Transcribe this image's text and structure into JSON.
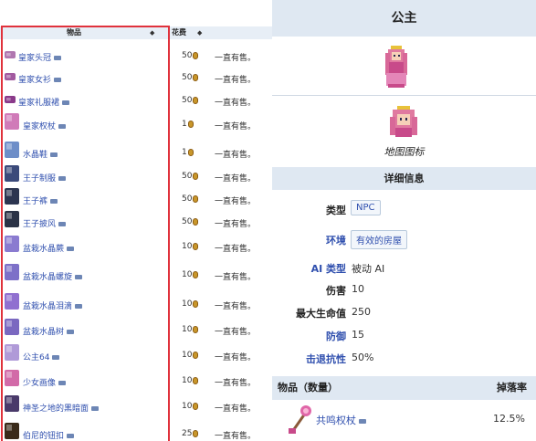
{
  "table": {
    "headers": {
      "item": "物品",
      "cost": "花费",
      "availability": ""
    },
    "rows": [
      {
        "name": "皇家头冠",
        "price": "50",
        "availability": "一直有售。",
        "icon": "crown-icon",
        "color": "#b077b0"
      },
      {
        "name": "皇家女衫",
        "price": "50",
        "availability": "一直有售。",
        "icon": "blouse-icon",
        "color": "#a25aa0"
      },
      {
        "name": "皇家礼服裙",
        "price": "50",
        "availability": "一直有售。",
        "icon": "gown-icon",
        "color": "#8a3a8a"
      },
      {
        "name": "皇家权杖",
        "price": "1",
        "availability": "一直有售。",
        "icon": "scepter-icon",
        "color": "#d07ab8"
      },
      {
        "name": "水晶鞋",
        "price": "1",
        "availability": "一直有售。",
        "icon": "glass-slipper-icon",
        "color": "#6e8ec8"
      },
      {
        "name": "王子制服",
        "price": "50",
        "availability": "一直有售。",
        "icon": "prince-uniform-icon",
        "color": "#3b4a7a"
      },
      {
        "name": "王子裤",
        "price": "50",
        "availability": "一直有售。",
        "icon": "prince-pants-icon",
        "color": "#2c3550"
      },
      {
        "name": "王子披风",
        "price": "50",
        "availability": "一直有售。",
        "icon": "prince-cape-icon",
        "color": "#2a3246"
      },
      {
        "name": "盆栽水晶蕨",
        "price": "10",
        "availability": "一直有售。",
        "icon": "crystal-fern-icon",
        "color": "#8a7bd0"
      },
      {
        "name": "盆栽水晶螺旋",
        "price": "10",
        "availability": "一直有售。",
        "icon": "crystal-spiral-icon",
        "color": "#7d70c8"
      },
      {
        "name": "盆栽水晶泪滴",
        "price": "10",
        "availability": "一直有售。",
        "icon": "crystal-teardrop-icon",
        "color": "#9070d0"
      },
      {
        "name": "盆栽水晶树",
        "price": "10",
        "availability": "一直有售。",
        "icon": "crystal-tree-icon",
        "color": "#7a68c0"
      },
      {
        "name": "公主64",
        "price": "10",
        "availability": "一直有售。",
        "icon": "princess64-icon",
        "color": "#b09ad8"
      },
      {
        "name": "少女画像",
        "price": "10",
        "availability": "一直有售。",
        "icon": "girl-portrait-icon",
        "color": "#d26aa8"
      },
      {
        "name": "神圣之地的黑暗面",
        "price": "10",
        "availability": "一直有售。",
        "icon": "dark-side-painting-icon",
        "color": "#4a3a6a"
      },
      {
        "name": "伯尼的钮扣",
        "price": "25",
        "availability": "一直有售。",
        "icon": "bernie-button-icon",
        "color": "#3a2a1a"
      }
    ]
  },
  "infobox": {
    "title": "公主",
    "map_icon_caption": "地图图标",
    "section_title": "详细信息",
    "fields": [
      {
        "label": "类型",
        "value": "NPC",
        "is_link_label": false,
        "is_pill": true
      },
      {
        "label": "环境",
        "value": "有效的房屋",
        "is_link_label": true,
        "is_pill": true
      },
      {
        "label": "AI 类型",
        "value": "被动 AI",
        "is_link_label": true,
        "is_pill": false
      },
      {
        "label": "伤害",
        "value": "10",
        "is_link_label": false,
        "is_pill": false
      },
      {
        "label": "最大生命值",
        "value": "250",
        "is_link_label": false,
        "is_pill": false
      },
      {
        "label": "防御",
        "value": "15",
        "is_link_label": true,
        "is_pill": false
      },
      {
        "label": "击退抗性",
        "value": "50%",
        "is_link_label": true,
        "is_pill": false
      }
    ],
    "drops": {
      "header_item": "物品（数量）",
      "header_rate": "掉落率",
      "items": [
        {
          "name": "共鸣权杖",
          "rate": "12.5%",
          "icon": "resonance-scepter-icon"
        }
      ]
    },
    "colors": {
      "header_bg": "#dfe8f2",
      "link": "#2f4fae",
      "highlight_border": "#e0323c"
    }
  }
}
